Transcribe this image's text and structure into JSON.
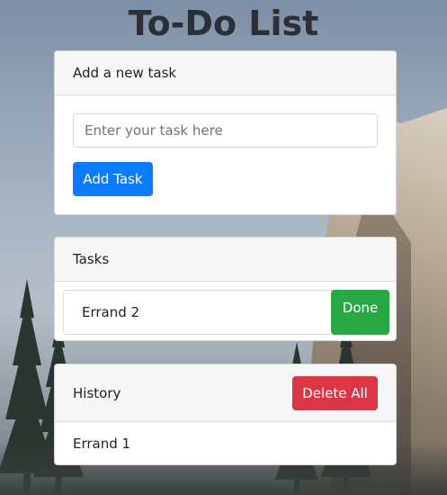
{
  "page": {
    "title": "To-Do List"
  },
  "add_card": {
    "header": "Add a new task",
    "input_placeholder": "Enter your task here",
    "input_value": "",
    "button_label": "Add Task"
  },
  "tasks_card": {
    "header": "Tasks",
    "items": [
      {
        "label": "Errand 2",
        "done_label": "Done"
      }
    ]
  },
  "history_card": {
    "header": "History",
    "delete_all_label": "Delete All",
    "items": [
      {
        "label": "Errand 1"
      }
    ]
  },
  "colors": {
    "primary": "#0d7bff",
    "success": "#28a745",
    "danger": "#dc3545"
  }
}
